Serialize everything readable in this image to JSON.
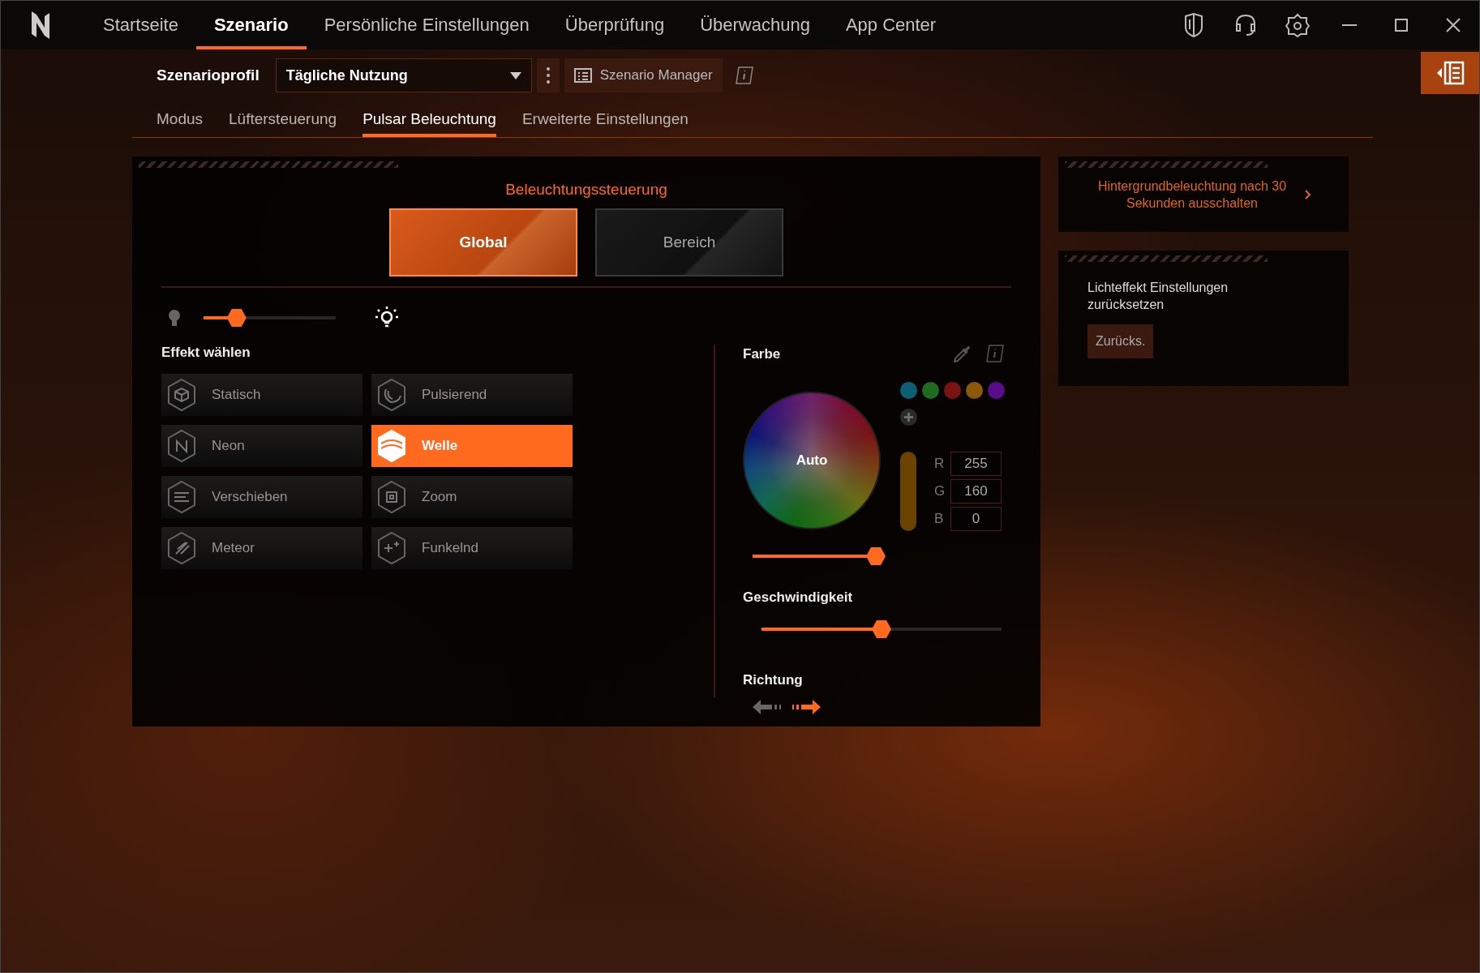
{
  "nav": {
    "tabs": [
      {
        "label": "Startseite",
        "selected": false
      },
      {
        "label": "Szenario",
        "selected": true
      },
      {
        "label": "Persönliche Einstellungen",
        "selected": false
      },
      {
        "label": "Überprüfung",
        "selected": false
      },
      {
        "label": "Überwachung",
        "selected": false
      },
      {
        "label": "App Center",
        "selected": false
      }
    ]
  },
  "profile": {
    "label": "Szenarioprofil",
    "value": "Tägliche Nutzung",
    "manager_button": "Szenario Manager"
  },
  "subtabs": [
    {
      "label": "Modus",
      "selected": false
    },
    {
      "label": "Lüftersteuerung",
      "selected": false
    },
    {
      "label": "Pulsar Beleuchtung",
      "selected": true
    },
    {
      "label": "Erweiterte Einstellungen",
      "selected": false
    }
  ],
  "lighting": {
    "title": "Beleuchtungssteuerung",
    "modes": [
      {
        "label": "Global",
        "selected": true
      },
      {
        "label": "Bereich",
        "selected": false
      }
    ],
    "brightness": {
      "level": 0.25
    },
    "effects_title": "Effekt wählen",
    "effects": [
      {
        "label": "Statisch",
        "kind": "static",
        "selected": false
      },
      {
        "label": "Pulsierend",
        "kind": "pulse",
        "selected": false
      },
      {
        "label": "Neon",
        "kind": "neon",
        "selected": false
      },
      {
        "label": "Welle",
        "kind": "wave",
        "selected": true
      },
      {
        "label": "Verschieben",
        "kind": "shift",
        "selected": false
      },
      {
        "label": "Zoom",
        "kind": "zoom",
        "selected": false
      },
      {
        "label": "Meteor",
        "kind": "meteor",
        "selected": false
      },
      {
        "label": "Funkelnd",
        "kind": "sparkle",
        "selected": false
      }
    ]
  },
  "color": {
    "title": "Farbe",
    "wheel_label": "Auto",
    "presets": [
      {
        "color": "#0f5f73"
      },
      {
        "color": "#1f6b1f"
      },
      {
        "color": "#7a1414"
      },
      {
        "color": "#8a5a08"
      },
      {
        "color": "#5a0d8a"
      }
    ],
    "saturation": {
      "level": 1
    },
    "channels": [
      {
        "label": "R",
        "value": "255"
      },
      {
        "label": "G",
        "value": "160"
      },
      {
        "label": "B",
        "value": "0"
      }
    ],
    "speed": {
      "title": "Geschwindigkeit",
      "level": 0.5
    },
    "direction": {
      "title": "Richtung",
      "options": [
        {
          "kind": "left",
          "selected": false
        },
        {
          "kind": "right",
          "selected": true
        }
      ]
    }
  },
  "side_cards": {
    "backlight_link": "Hintergrundbeleuchtung nach 30 Sekunden ausschalten",
    "reset": {
      "text": "Lichteffekt Einstellungen zurücksetzen",
      "button": "Zurücks."
    }
  }
}
